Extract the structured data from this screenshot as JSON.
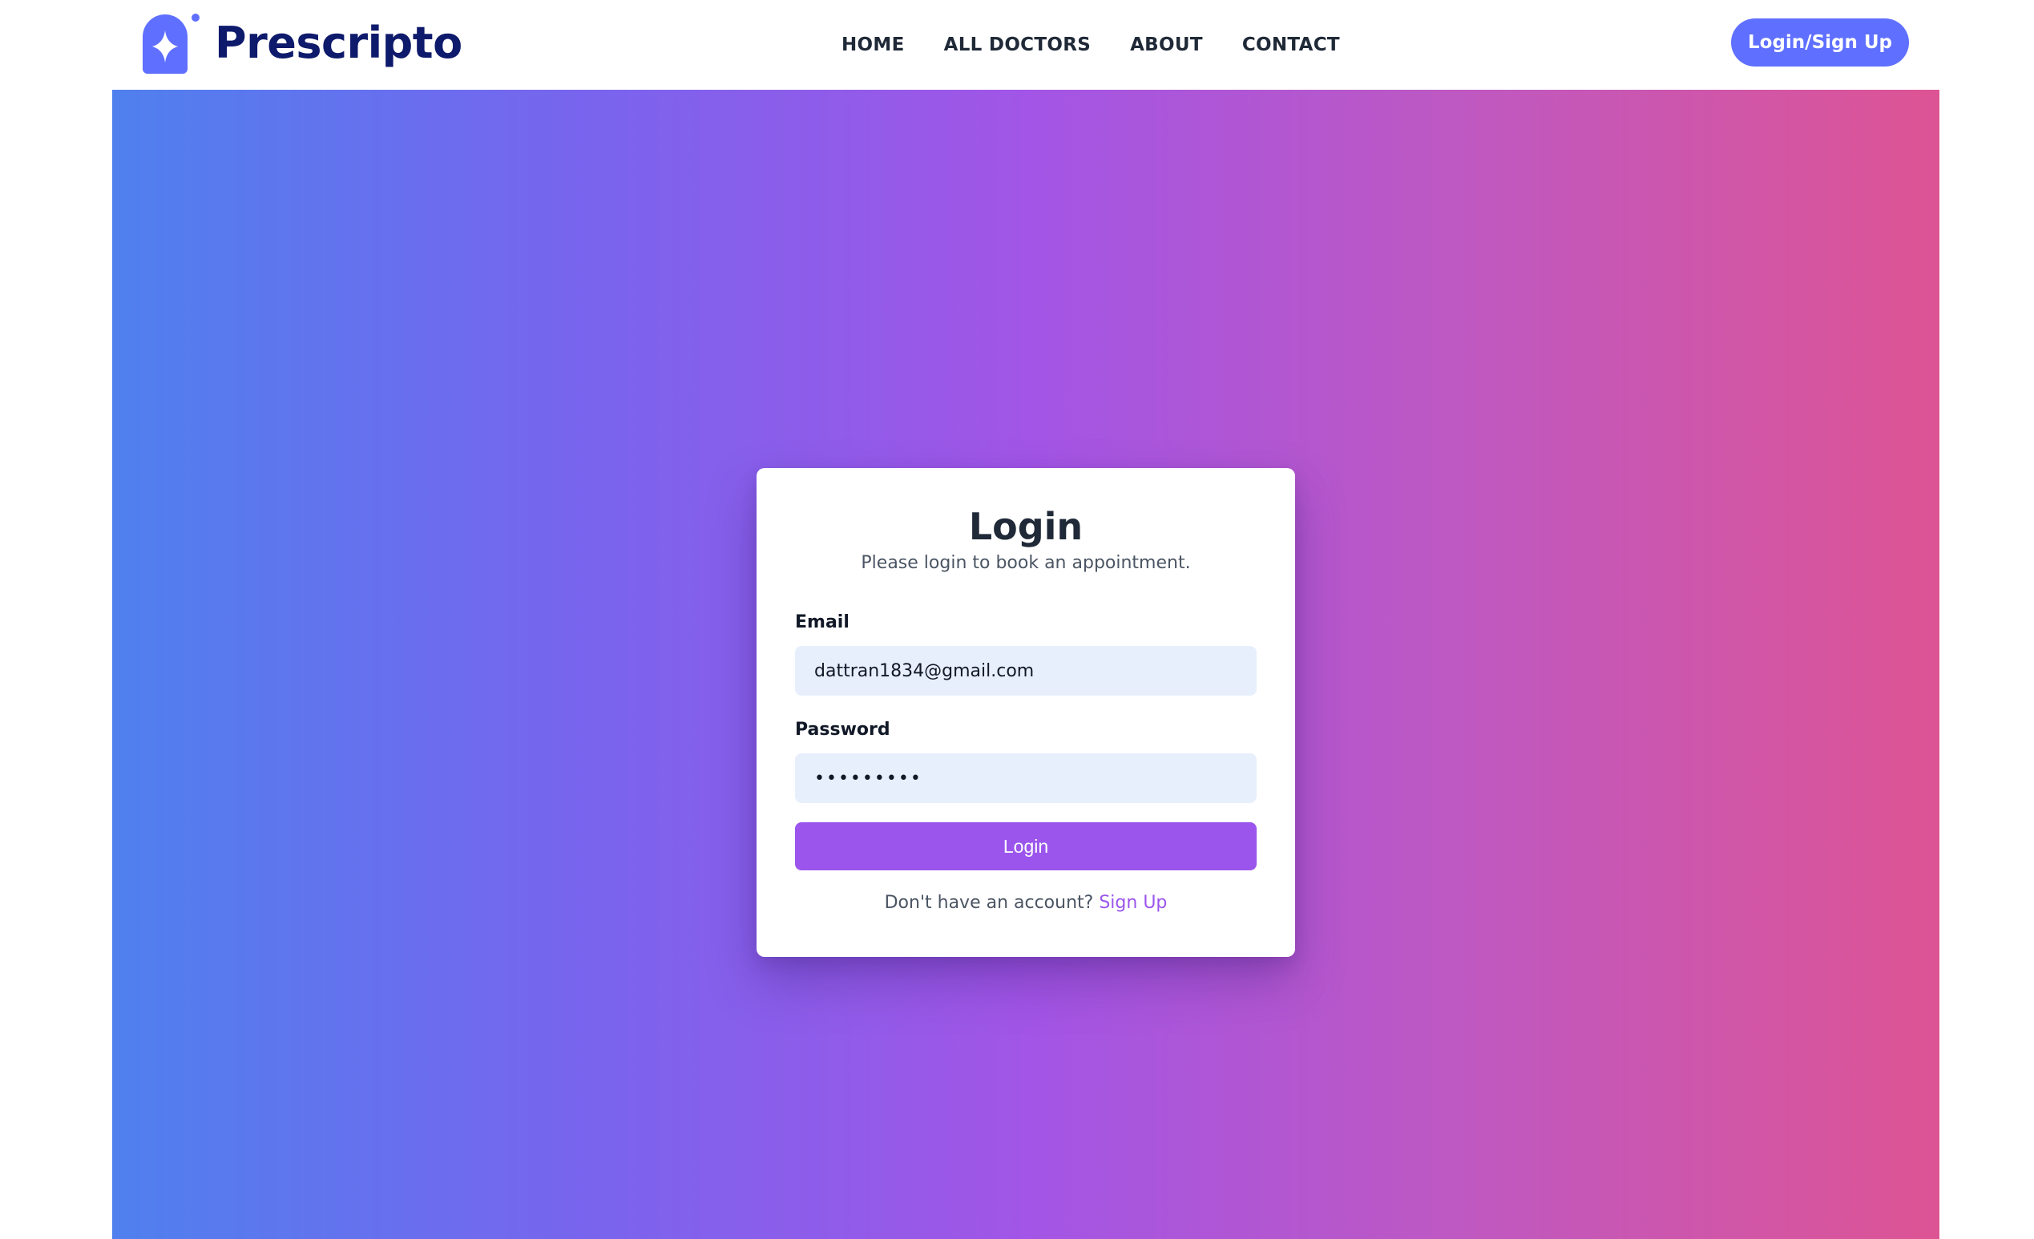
{
  "navbar": {
    "logo_text": "Prescripto",
    "links": [
      "HOME",
      "ALL DOCTORS",
      "ABOUT",
      "CONTACT"
    ],
    "cta_label": "Login/Sign Up",
    "brand_color": "#5f6fff",
    "logo_text_color": "#0e1a6b"
  },
  "hero": {
    "gradient_colors": [
      "#4f80ee",
      "#a255e6",
      "#dd5494"
    ]
  },
  "login_card": {
    "title": "Login",
    "subtitle": "Please login to book an appointment.",
    "email": {
      "label": "Email",
      "value": "dattran1834@gmail.com"
    },
    "password": {
      "label": "Password",
      "value": "•••••••••"
    },
    "submit_label": "Login",
    "submit_color": "#9b55ec",
    "signup_prompt": "Don't have an account?",
    "signup_link": "Sign Up"
  },
  "icons": {
    "logo": "prescripto-logo-icon"
  }
}
